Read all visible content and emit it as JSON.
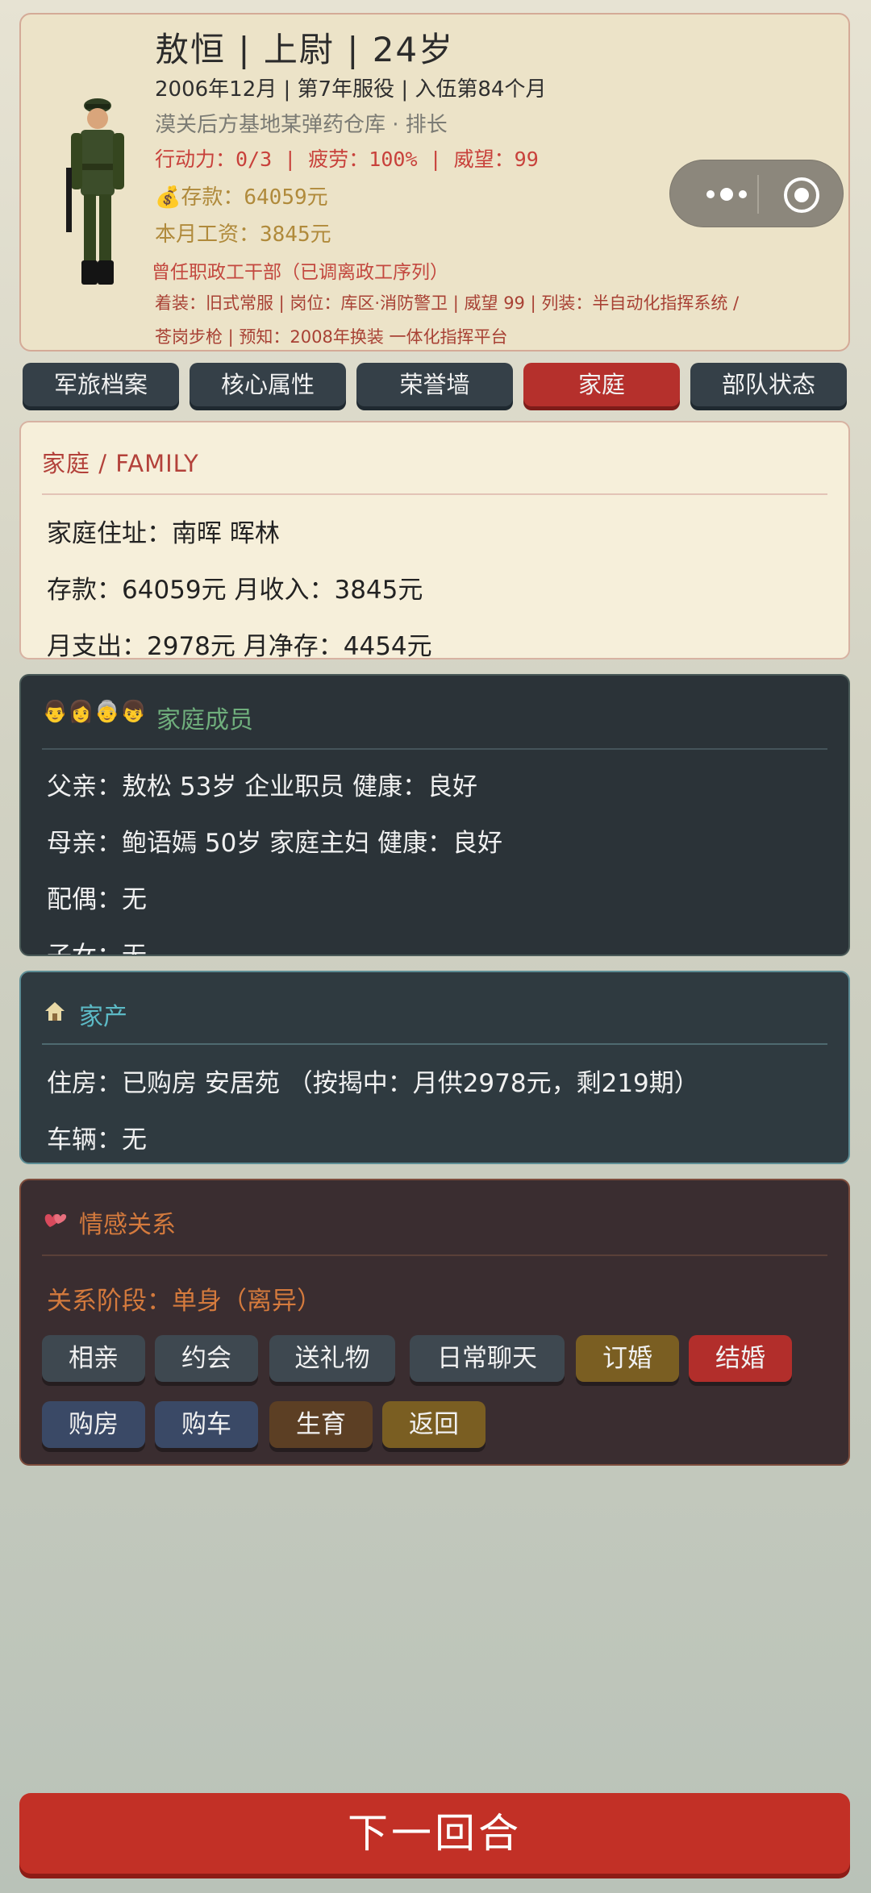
{
  "header": {
    "title": "敖恒 | 上尉 | 24岁",
    "service": "2006年12月 | 第7年服役 | 入伍第84个月",
    "unit": "漠关后方基地某弹药仓库 · 排长",
    "stats": "行动力：0/3 | 疲劳：100% | 威望：99",
    "money_icon": "💰",
    "savings": "存款：64059元",
    "salary": "本月工资：3845元",
    "former_post": "曾任职政工干部（已调离政工序列）",
    "detail_line1": "着装：旧式常服 | 岗位：库区·消防警卫 | 威望 99 | 列装：半自动化指挥系统 /",
    "detail_line2": "苍岗步枪 | 预知：2008年换装 一体化指挥平台"
  },
  "tabs": [
    "军旅档案",
    "核心属性",
    "荣誉墙",
    "家庭",
    "部队状态"
  ],
  "active_tab": "家庭",
  "family": {
    "title": "家庭 / FAMILY",
    "address": "家庭住址：南晖 晖林",
    "finance1": "存款：64059元   月收入：3845元",
    "finance2": "月支出：2978元   月净存：4454元"
  },
  "members": {
    "emojis": "👨👩👵👦",
    "title": "家庭成员",
    "father": "父亲：敖松   53岁   企业职员   健康：良好",
    "mother": "母亲：鲍语嫣   50岁   家庭主妇   健康：良好",
    "spouse": "配偶：无",
    "children": "子女：无"
  },
  "estate": {
    "title": "家产",
    "house": "住房：已购房   安居苑   （按揭中：月供2978元，剩219期）",
    "vehicle": "车辆：无"
  },
  "romance": {
    "title": "情感关系",
    "stage": "关系阶段：单身（离异）",
    "buttons_row1": [
      "相亲",
      "约会",
      "送礼物",
      "日常聊天",
      "订婚",
      "结婚"
    ],
    "buttons_row2": [
      "购房",
      "购车",
      "生育",
      "返回"
    ]
  },
  "next_button": "下一回合",
  "colors": {
    "accent_red": "#b5302c",
    "tab_dark": "#354048",
    "members_title": "#6fae7c",
    "estate_title": "#5cbac6",
    "romance_title": "#d47a3d"
  }
}
